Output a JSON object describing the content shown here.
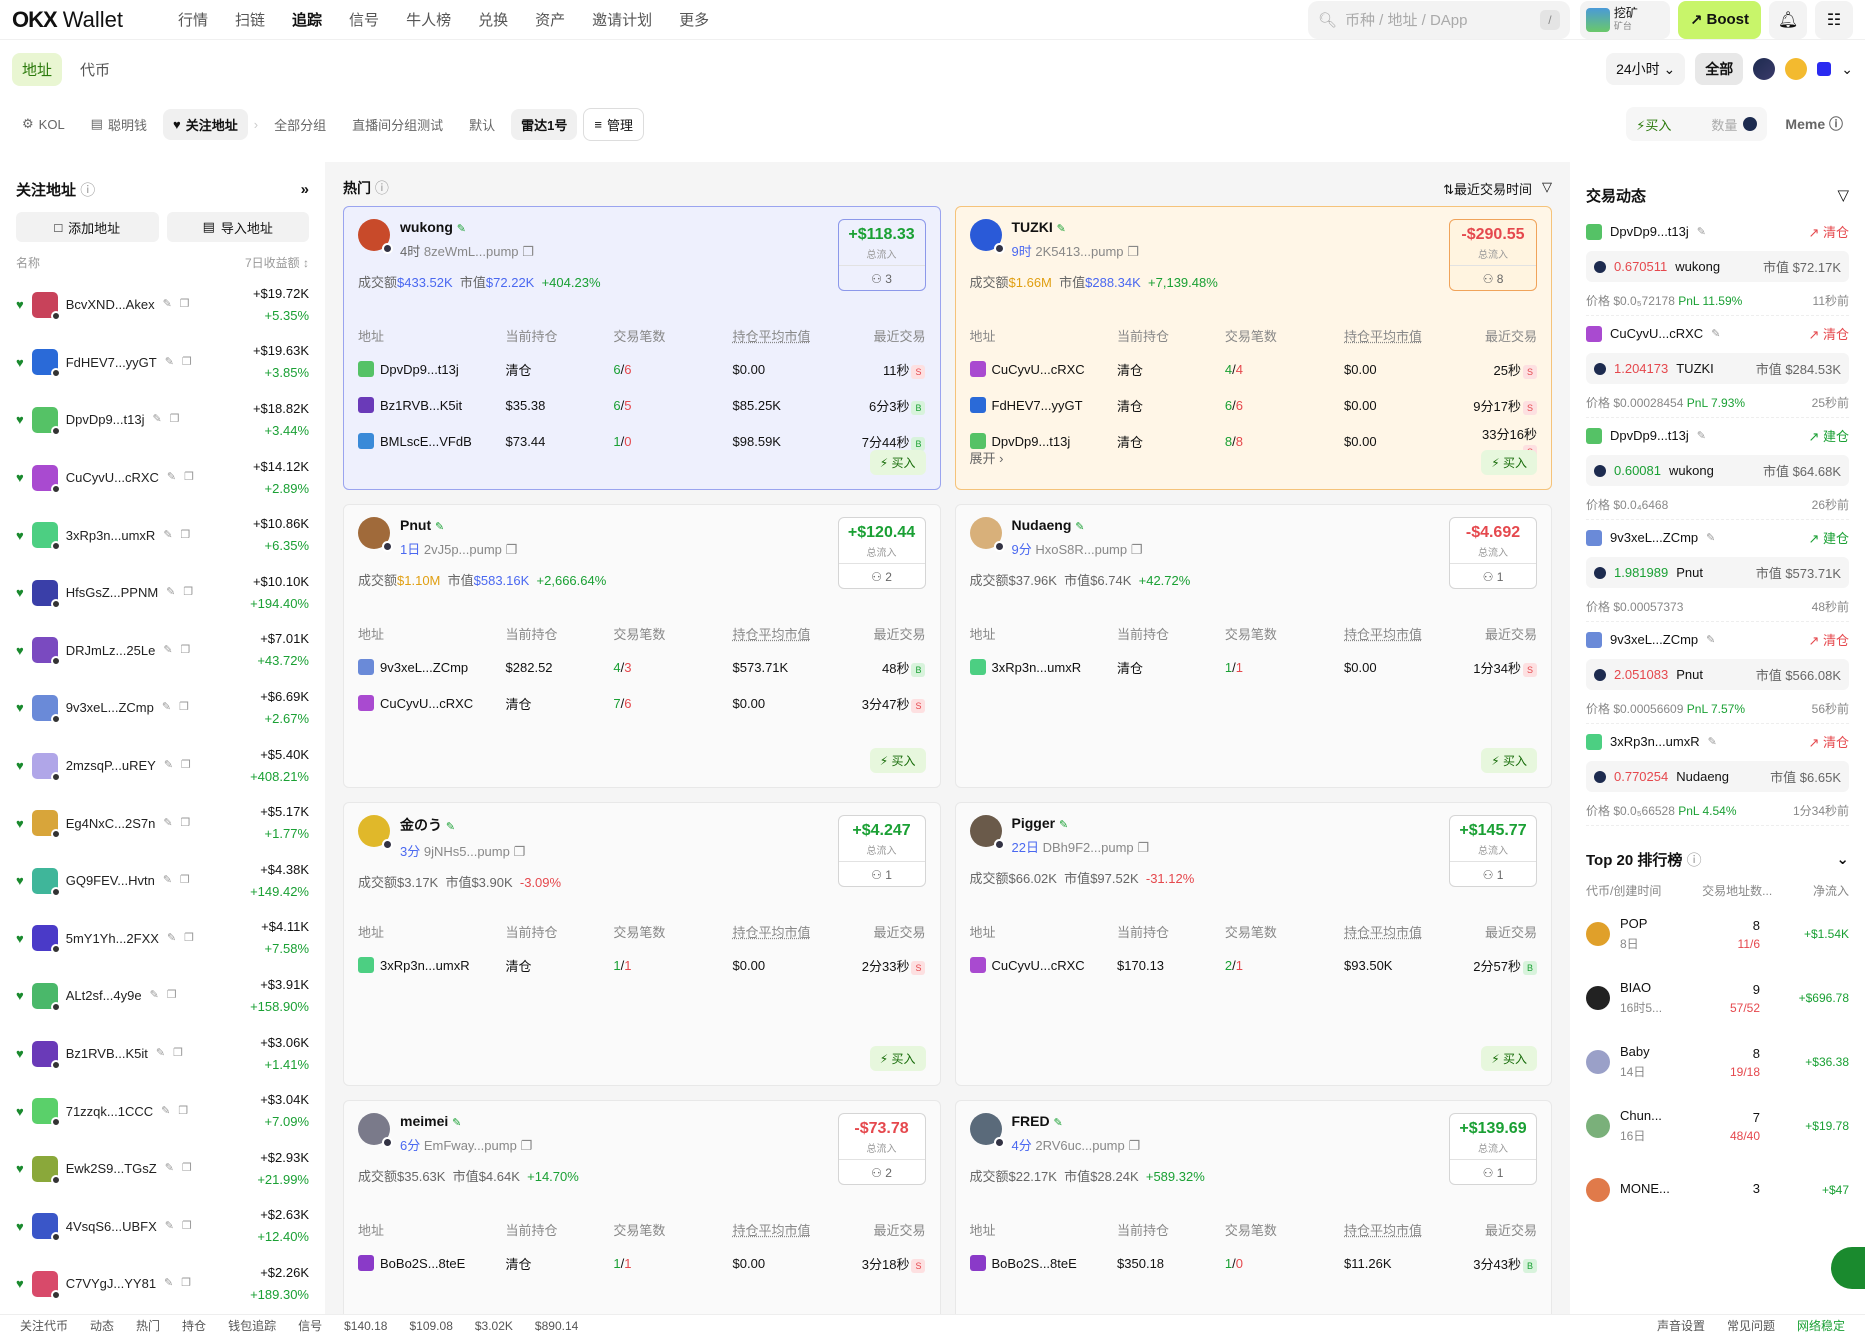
{
  "app": {
    "logo": "OKX",
    "name": "Wallet"
  },
  "nav": [
    "行情",
    "扫链",
    "追踪",
    "信号",
    "牛人榜",
    "兑换",
    "资产",
    "邀请计划",
    "更多"
  ],
  "nav_active": "追踪",
  "search": {
    "placeholder": "币种 / 地址 / DApp",
    "shortcut": "/"
  },
  "mining": {
    "line1": "挖矿",
    "line2": "矿台"
  },
  "boost_label": "Boost",
  "row2": {
    "tabs": [
      "地址",
      "代币"
    ],
    "period": "24小时",
    "all": "全部"
  },
  "row3": {
    "tabs": [
      "KOL",
      "聪明钱",
      "关注地址",
      "全部分组",
      "直播间分组测试",
      "默认",
      "雷达1号"
    ],
    "manage": "管理",
    "buy": "买入",
    "qty": "数量",
    "meme": "Meme"
  },
  "sidebar": {
    "title": "关注地址",
    "add": "添加地址",
    "import": "导入地址",
    "col_name": "名称",
    "col_profit": "7日收益额",
    "rows": [
      {
        "name": "BcvXND...Akex",
        "amt": "+$19.72K",
        "pct": "+5.35%",
        "c": "#c8425a"
      },
      {
        "name": "FdHEV7...yyGT",
        "amt": "+$19.63K",
        "pct": "+3.85%",
        "c": "#2a6ad8"
      },
      {
        "name": "DpvDp9...t13j",
        "amt": "+$18.82K",
        "pct": "+3.44%",
        "c": "#55c266"
      },
      {
        "name": "CuCyvU...cRXC",
        "amt": "+$14.12K",
        "pct": "+2.89%",
        "c": "#a94ad0"
      },
      {
        "name": "3xRp3n...umxR",
        "amt": "+$10.86K",
        "pct": "+6.35%",
        "c": "#4ccf82"
      },
      {
        "name": "HfsGsZ...PPNM",
        "amt": "+$10.10K",
        "pct": "+194.40%",
        "c": "#3a3fa8"
      },
      {
        "name": "DRJmLz...25Le",
        "amt": "+$7.01K",
        "pct": "+43.72%",
        "c": "#7a4ac0"
      },
      {
        "name": "9v3xeL...ZCmp",
        "amt": "+$6.69K",
        "pct": "+2.67%",
        "c": "#6a8ad8"
      },
      {
        "name": "2mzsqP...uREY",
        "amt": "+$5.40K",
        "pct": "+408.21%",
        "c": "#b0a6e8"
      },
      {
        "name": "Eg4NxC...2S7n",
        "amt": "+$5.17K",
        "pct": "+1.77%",
        "c": "#d8a53a"
      },
      {
        "name": "GQ9FEV...Hvtn",
        "amt": "+$4.38K",
        "pct": "+149.42%",
        "c": "#3fb69a"
      },
      {
        "name": "5mY1Yh...2FXX",
        "amt": "+$4.11K",
        "pct": "+7.58%",
        "c": "#4a3ac8"
      },
      {
        "name": "ALt2sf...4y9e",
        "amt": "+$3.91K",
        "pct": "+158.90%",
        "c": "#4ab86a"
      },
      {
        "name": "Bz1RVB...K5it",
        "amt": "+$3.06K",
        "pct": "+1.41%",
        "c": "#6a3ab8"
      },
      {
        "name": "71zzqk...1CCC",
        "amt": "+$3.04K",
        "pct": "+7.09%",
        "c": "#5ad06a"
      },
      {
        "name": "Ewk2S9...TGsZ",
        "amt": "+$2.93K",
        "pct": "+21.99%",
        "c": "#8aa83a"
      },
      {
        "name": "4VsqS6...UBFX",
        "amt": "+$2.63K",
        "pct": "+12.40%",
        "c": "#3a56c8"
      },
      {
        "name": "C7VYgJ...YY81",
        "amt": "+$2.26K",
        "pct": "+189.30%",
        "c": "#d84a6a"
      }
    ]
  },
  "center": {
    "title": "热门",
    "sort": "最近交易时间",
    "th": [
      "地址",
      "当前持仓",
      "交易笔数",
      "持仓平均市值",
      "最近交易"
    ],
    "buy": "买入",
    "flow_label": "总流入",
    "expand": "展开",
    "cards": [
      {
        "name": "wukong",
        "age": "4时",
        "addr": "8zeWmL...pump",
        "vol": "$433.52K",
        "mcap": "$72.22K",
        "chg": "+404.23%",
        "flow": "+$118.33",
        "cnt": "3",
        "style": "blue",
        "vcol": "b",
        "av": "#c84a2a",
        "rows": [
          {
            "who": "DpvDp9...t13j",
            "hold": "清仓",
            "tx": "6",
            "tx2": "6",
            "avg": "$0.00",
            "last": "11秒",
            "t": "S",
            "c": "#55c266"
          },
          {
            "who": "Bz1RVB...K5it",
            "hold": "$35.38",
            "tx": "6",
            "tx2": "5",
            "avg": "$85.25K",
            "last": "6分3秒",
            "t": "B",
            "c": "#6a3ab8"
          },
          {
            "who": "BMLscE...VFdB",
            "hold": "$73.44",
            "tx": "1",
            "tx2": "0",
            "avg": "$98.59K",
            "last": "7分44秒",
            "t": "B",
            "c": "#3a8ad8"
          }
        ]
      },
      {
        "name": "TUZKI",
        "age": "9时",
        "addr": "2K5413...pump",
        "vol": "$1.66M",
        "mcap": "$288.34K",
        "chg": "+7,139.48%",
        "flow": "-$290.55",
        "cnt": "8",
        "style": "orange",
        "vcol": "o",
        "av": "#2a5ad8",
        "expand": true,
        "rows": [
          {
            "who": "CuCyvU...cRXC",
            "hold": "清仓",
            "tx": "4",
            "tx2": "4",
            "avg": "$0.00",
            "last": "25秒",
            "t": "S",
            "c": "#a94ad0"
          },
          {
            "who": "FdHEV7...yyGT",
            "hold": "清仓",
            "tx": "6",
            "tx2": "6",
            "avg": "$0.00",
            "last": "9分17秒",
            "t": "S",
            "c": "#2a6ad8"
          },
          {
            "who": "DpvDp9...t13j",
            "hold": "清仓",
            "tx": "8",
            "tx2": "8",
            "avg": "$0.00",
            "last": "33分16秒",
            "t": "S",
            "c": "#55c266"
          }
        ]
      },
      {
        "name": "Pnut",
        "age": "1日",
        "addr": "2vJ5p...pump",
        "vol": "$1.10M",
        "mcap": "$583.16K",
        "chg": "+2,666.64%",
        "flow": "+$120.44",
        "cnt": "2",
        "style": "",
        "vcol": "o",
        "av": "#a06a3a",
        "rows": [
          {
            "who": "9v3xeL...ZCmp",
            "hold": "$282.52",
            "tx": "4",
            "tx2": "3",
            "avg": "$573.71K",
            "last": "48秒",
            "t": "B",
            "c": "#6a8ad8"
          },
          {
            "who": "CuCyvU...cRXC",
            "hold": "清仓",
            "tx": "7",
            "tx2": "6",
            "avg": "$0.00",
            "last": "3分47秒",
            "t": "S",
            "c": "#a94ad0"
          }
        ]
      },
      {
        "name": "Nudaeng",
        "age": "9分",
        "addr": "HxoS8R...pump",
        "vol": "$37.96K",
        "mcap": "$6.74K",
        "chg": "+42.72%",
        "flow": "-$4.692",
        "cnt": "1",
        "style": "",
        "vcol": "",
        "av": "#d8b07a",
        "rows": [
          {
            "who": "3xRp3n...umxR",
            "hold": "清仓",
            "tx": "1",
            "tx2": "1",
            "avg": "$0.00",
            "last": "1分34秒",
            "t": "S",
            "c": "#4ccf82"
          }
        ]
      },
      {
        "name": "金のう",
        "age": "3分",
        "addr": "9jNHs5...pump",
        "vol": "$3.17K",
        "mcap": "$3.90K",
        "chg": "-3.09%",
        "flow": "+$4.247",
        "cnt": "1",
        "style": "",
        "vcol": "",
        "av": "#e0b82a",
        "rows": [
          {
            "who": "3xRp3n...umxR",
            "hold": "清仓",
            "tx": "1",
            "tx2": "1",
            "avg": "$0.00",
            "last": "2分33秒",
            "t": "S",
            "c": "#4ccf82"
          }
        ]
      },
      {
        "name": "Pigger",
        "age": "22日",
        "addr": "DBh9F2...pump",
        "vol": "$66.02K",
        "mcap": "$97.52K",
        "chg": "-31.12%",
        "flow": "+$145.77",
        "cnt": "1",
        "style": "",
        "vcol": "",
        "av": "#6a5a4a",
        "rows": [
          {
            "who": "CuCyvU...cRXC",
            "hold": "$170.13",
            "tx": "2",
            "tx2": "1",
            "avg": "$93.50K",
            "last": "2分57秒",
            "t": "B",
            "c": "#a94ad0"
          }
        ]
      },
      {
        "name": "meimei",
        "age": "6分",
        "addr": "EmFway...pump",
        "vol": "$35.63K",
        "mcap": "$4.64K",
        "chg": "+14.70%",
        "flow": "-$73.78",
        "cnt": "2",
        "style": "",
        "vcol": "",
        "av": "#7a7a8a",
        "rows": [
          {
            "who": "BoBo2S...8teE",
            "hold": "清仓",
            "tx": "1",
            "tx2": "1",
            "avg": "$0.00",
            "last": "3分18秒",
            "t": "S",
            "c": "#8a3ac8"
          }
        ]
      },
      {
        "name": "FRED",
        "age": "4分",
        "addr": "2RV6uc...pump",
        "vol": "$22.17K",
        "mcap": "$28.24K",
        "chg": "+589.32%",
        "flow": "+$139.69",
        "cnt": "1",
        "style": "",
        "vcol": "",
        "av": "#5a6a7a",
        "rows": [
          {
            "who": "BoBo2S...8teE",
            "hold": "$350.18",
            "tx": "1",
            "tx2": "0",
            "avg": "$11.26K",
            "last": "3分43秒",
            "t": "B",
            "c": "#8a3ac8"
          }
        ]
      }
    ]
  },
  "right": {
    "title": "交易动态",
    "top_title": "Top 20 排行榜",
    "top_cols": [
      "代币/创建时间",
      "交易地址数...",
      "净流入"
    ],
    "txs": [
      {
        "who": "DpvDp9...t13j",
        "act": "清仓",
        "amt": "0.670511",
        "token": "wukong",
        "mcap": "市值 $72.17K",
        "price": "价格 $0.0₅72178",
        "pnl": "PnL 11.59%",
        "ago": "11秒前",
        "neg": true,
        "c": "#55c266"
      },
      {
        "who": "CuCyvU...cRXC",
        "act": "清仓",
        "amt": "1.204173",
        "token": "TUZKI",
        "mcap": "市值 $284.53K",
        "price": "价格 $0.00028454",
        "pnl": "PnL 7.93%",
        "ago": "25秒前",
        "neg": true,
        "c": "#a94ad0"
      },
      {
        "who": "DpvDp9...t13j",
        "act": "建仓",
        "amt": "0.60081",
        "token": "wukong",
        "mcap": "市值 $64.68K",
        "price": "价格 $0.0₄6468",
        "pnl": "",
        "ago": "26秒前",
        "neg": false,
        "c": "#55c266"
      },
      {
        "who": "9v3xeL...ZCmp",
        "act": "建仓",
        "amt": "1.981989",
        "token": "Pnut",
        "mcap": "市值 $573.71K",
        "price": "价格 $0.00057373",
        "pnl": "",
        "ago": "48秒前",
        "neg": false,
        "c": "#6a8ad8"
      },
      {
        "who": "9v3xeL...ZCmp",
        "act": "清仓",
        "amt": "2.051083",
        "token": "Pnut",
        "mcap": "市值 $566.08K",
        "price": "价格 $0.00056609",
        "pnl": "PnL 7.57%",
        "ago": "56秒前",
        "neg": true,
        "c": "#6a8ad8"
      },
      {
        "who": "3xRp3n...umxR",
        "act": "清仓",
        "amt": "0.770254",
        "token": "Nudaeng",
        "mcap": "市值 $6.65K",
        "price": "价格 $0.0₅66528",
        "pnl": "PnL 4.54%",
        "ago": "1分34秒前",
        "neg": true,
        "c": "#4ccf82"
      }
    ],
    "top": [
      {
        "name": "POP",
        "age": "8日",
        "n": "8",
        "ratio": "11/6",
        "flow": "+$1.54K",
        "c": "#e0a02a"
      },
      {
        "name": "BIAO",
        "age": "16时5...",
        "n": "9",
        "ratio": "57/52",
        "flow": "+$696.78",
        "c": "#222"
      },
      {
        "name": "Baby",
        "age": "14日",
        "n": "8",
        "ratio": "19/18",
        "flow": "+$36.38",
        "c": "#9aa0c8"
      },
      {
        "name": "Chun...",
        "age": "16日",
        "n": "7",
        "ratio": "48/40",
        "flow": "+$19.78",
        "c": "#7ab07a"
      },
      {
        "name": "MONE...",
        "age": "",
        "n": "3",
        "ratio": "",
        "flow": "+$47",
        "c": "#e07a4a"
      }
    ]
  },
  "bottom": {
    "left": [
      "关注代币",
      "动态",
      "热门",
      "持仓",
      "钱包追踪",
      "信号"
    ],
    "prices": [
      "$140.18",
      "$109.08",
      "$3.02K",
      "$890.14"
    ],
    "right": [
      "声音设置",
      "常见问题",
      "网络稳定"
    ]
  }
}
